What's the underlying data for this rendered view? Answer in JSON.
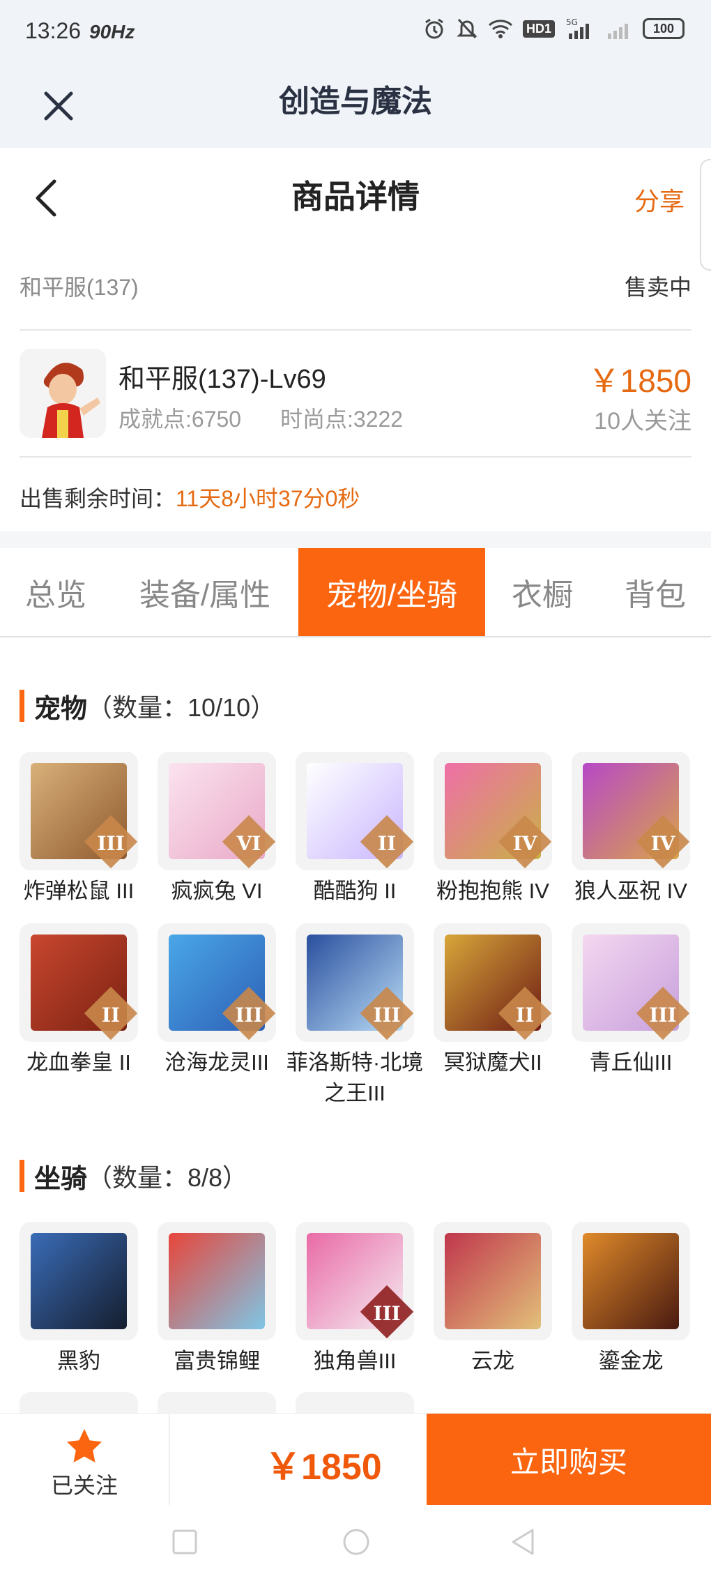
{
  "status_bar": {
    "time": "13:26",
    "refresh": "90Hz",
    "network_badge": "HD1",
    "signal_label": "5G",
    "battery": "100"
  },
  "app_header": {
    "title": "创造与魔法"
  },
  "nav": {
    "title": "商品详情",
    "share": "分享"
  },
  "server": {
    "name": "和平服(137)",
    "status": "售卖中"
  },
  "product": {
    "title": "和平服(137)-Lv69",
    "achievement": "成就点:6750",
    "fashion": "时尚点:3222",
    "price": "￥1850",
    "followers": "10人关注"
  },
  "sale_time": {
    "label": "出售剩余时间：",
    "value": "11天8小时37分0秒"
  },
  "tabs": [
    {
      "label": "总览"
    },
    {
      "label": "装备/属性"
    },
    {
      "label": "宠物/坐骑"
    },
    {
      "label": "衣橱"
    },
    {
      "label": "背包"
    }
  ],
  "pets": {
    "title": "宠物",
    "count": "（数量：10/10）",
    "items": [
      {
        "name": "炸弹松鼠 III",
        "rank": "III"
      },
      {
        "name": "疯疯兔 VI",
        "rank": "VI"
      },
      {
        "name": "酷酷狗 II",
        "rank": "II"
      },
      {
        "name": "粉抱抱熊 IV",
        "rank": "IV"
      },
      {
        "name": "狼人巫祝 IV",
        "rank": "IV"
      },
      {
        "name": "龙血拳皇 II",
        "rank": "II"
      },
      {
        "name": "沧海龙灵III",
        "rank": "III"
      },
      {
        "name": "菲洛斯特·北境之王III",
        "rank": "III"
      },
      {
        "name": "冥狱魔犬II",
        "rank": "II"
      },
      {
        "name": "青丘仙III",
        "rank": "III"
      }
    ]
  },
  "mounts": {
    "title": "坐骑",
    "count": "（数量：8/8）",
    "items": [
      {
        "name": "黑豹",
        "rank": ""
      },
      {
        "name": "富贵锦鲤",
        "rank": ""
      },
      {
        "name": "独角兽III",
        "rank": "III"
      },
      {
        "name": "云龙",
        "rank": ""
      },
      {
        "name": "鎏金龙",
        "rank": ""
      }
    ]
  },
  "bottom": {
    "follow": "已关注",
    "price": "￥1850",
    "buy": "立即购买"
  },
  "colors": {
    "accent": "#fb6510",
    "price": "#e56a12"
  }
}
